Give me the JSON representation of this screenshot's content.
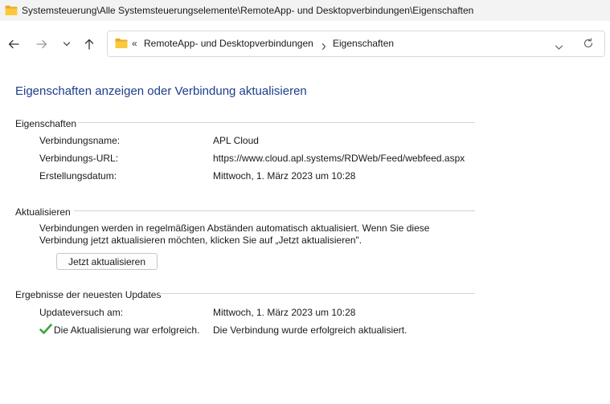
{
  "window": {
    "title": "Systemsteuerung\\Alle Systemsteuerungselemente\\RemoteApp- und Desktopverbindungen\\Eigenschaften",
    "title_icon": "folder-icon"
  },
  "navigation": {
    "back_icon": "arrow-left-icon",
    "forward_icon": "arrow-right-icon",
    "recent_icon": "chevron-down-icon",
    "up_icon": "arrow-up-icon",
    "address": {
      "overflow": "«",
      "crumbs": [
        "RemoteApp- und Desktopverbindungen",
        "Eigenschaften"
      ],
      "dropdown_icon": "chevron-down-icon",
      "refresh_icon": "refresh-icon"
    }
  },
  "page": {
    "heading": "Eigenschaften anzeigen oder Verbindung aktualisieren",
    "properties": {
      "title": "Eigenschaften",
      "rows": [
        {
          "label": "Verbindungsname:",
          "value": "APL Cloud"
        },
        {
          "label": "Verbindungs-URL:",
          "value": "https://www.cloud.apl.systems/RDWeb/Feed/webfeed.aspx"
        },
        {
          "label": "Erstellungsdatum:",
          "value": "Mittwoch, 1. März 2023 um 10:28"
        }
      ]
    },
    "update": {
      "title": "Aktualisieren",
      "description_line1": "Verbindungen werden in regelmäßigen Abständen automatisch aktualisiert. Wenn Sie diese",
      "description_line2": "Verbindung jetzt aktualisieren möchten, klicken Sie auf „Jetzt aktualisieren\".",
      "button_label": "Jetzt aktualisieren"
    },
    "results": {
      "title": "Ergebnisse der neuesten Updates",
      "attempt_label": "Updateversuch am:",
      "attempt_value": "Mittwoch, 1. März 2023 um 10:28",
      "status_label": "Die Aktualisierung war erfolgreich.",
      "status_value": "Die Verbindung wurde erfolgreich aktualisiert.",
      "status_icon": "check-icon",
      "status_color": "#3aa33a"
    }
  }
}
